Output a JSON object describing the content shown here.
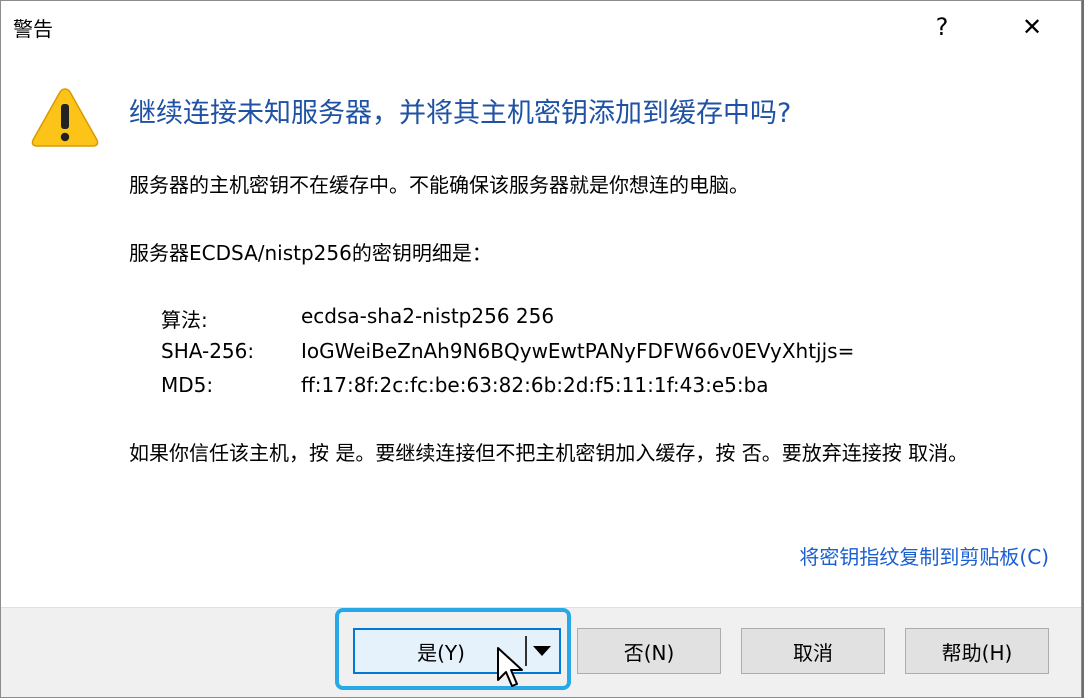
{
  "window": {
    "title": "警告",
    "help_label": "?",
    "close_label": "✕"
  },
  "icon": "warning-icon",
  "heading": "继续连接未知服务器，并将其主机密钥添加到缓存中吗?",
  "message1": "服务器的主机密钥不在缓存中。不能确保该服务器就是你想连的电脑。",
  "message2": "服务器ECDSA/nistp256的密钥明细是：",
  "key_details": [
    {
      "key": "算法:",
      "value": "ecdsa-sha2-nistp256 256"
    },
    {
      "key": "SHA-256:",
      "value": "IoGWeiBeZnAh9N6BQywEwtPANyFDFW66v0EVyXhtjjs="
    },
    {
      "key": "MD5:",
      "value": "ff:17:8f:2c:fc:be:63:82:6b:2d:f5:11:1f:43:e5:ba"
    }
  ],
  "message3": "如果你信任该主机，按 是。要继续连接但不把主机密钥加入缓存，按 否。要放弃连接按 取消。",
  "copy_link": "将密钥指纹复制到剪贴板(C)",
  "buttons": {
    "yes": "是(Y)",
    "no": "否(N)",
    "cancel": "取消",
    "help": "帮助(H)"
  },
  "colors": {
    "heading": "#1f52a4",
    "link": "#1a5fd0",
    "focus_ring": "#27a9e8",
    "default_button_border": "#0078d7"
  }
}
